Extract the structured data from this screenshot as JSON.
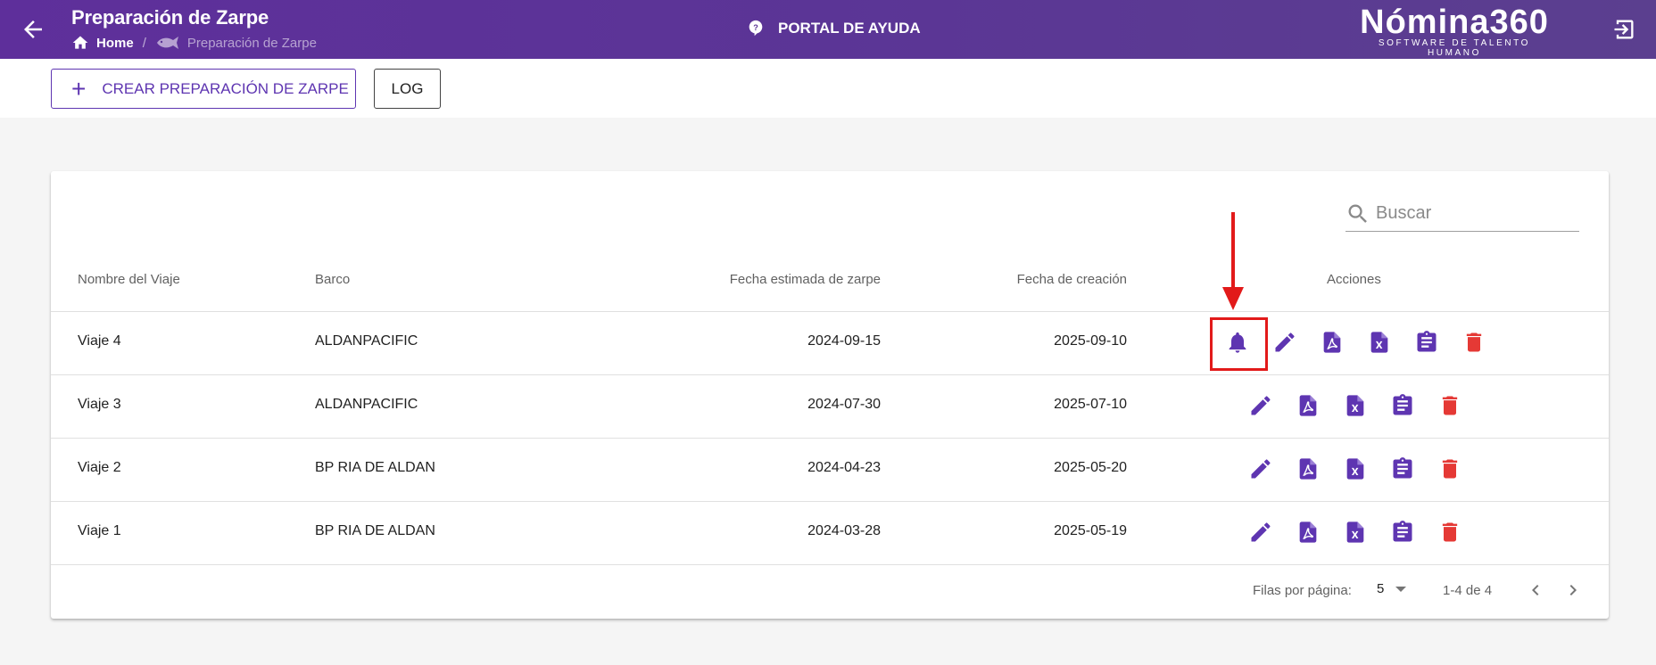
{
  "header": {
    "title": "Preparación de Zarpe",
    "breadcrumb": {
      "home": "Home",
      "separator": "/",
      "current": "Preparación de Zarpe"
    },
    "help_label": "PORTAL DE AYUDA",
    "logo_name": "Nómina360",
    "logo_tagline": "SOFTWARE DE TALENTO HUMANO",
    "colors": {
      "bar_start": "#5e2f9b",
      "bar_end": "#5b3f8f"
    },
    "icons": {
      "back": "arrow-left-icon",
      "home": "home-icon",
      "current": "fish-icon",
      "help": "help-circle-icon",
      "logout": "logout-icon"
    }
  },
  "toolbar": {
    "create_label": "CREAR PREPARACIÓN DE ZARPE",
    "create_icon": "plus-icon",
    "log_label": "LOG"
  },
  "search": {
    "placeholder": "Buscar",
    "icon": "search-icon"
  },
  "table": {
    "columns": [
      "Nombre del Viaje",
      "Barco",
      "Fecha estimada de zarpe",
      "Fecha de creación",
      "Acciones"
    ],
    "rows": [
      {
        "name": "Viaje 4",
        "boat": "ALDANPACIFIC",
        "est_date": "2024-09-15",
        "created": "2025-09-10",
        "has_bell": true
      },
      {
        "name": "Viaje 3",
        "boat": "ALDANPACIFIC",
        "est_date": "2024-07-30",
        "created": "2025-07-10",
        "has_bell": false
      },
      {
        "name": "Viaje 2",
        "boat": "BP RIA DE ALDAN",
        "est_date": "2024-04-23",
        "created": "2025-05-20",
        "has_bell": false
      },
      {
        "name": "Viaje 1",
        "boat": "BP RIA DE ALDAN",
        "est_date": "2024-03-28",
        "created": "2025-05-19",
        "has_bell": false
      }
    ],
    "action_icons": [
      "bell-icon",
      "edit-icon",
      "pdf-icon",
      "excel-icon",
      "clipboard-icon",
      "delete-icon"
    ],
    "colors": {
      "action": "#5e35b1",
      "delete": "#e53935"
    }
  },
  "pagination": {
    "rows_label": "Filas por página:",
    "rows_value": "5",
    "range": "1-4 de 4"
  },
  "annotation": {
    "color": "#e21a1a"
  }
}
